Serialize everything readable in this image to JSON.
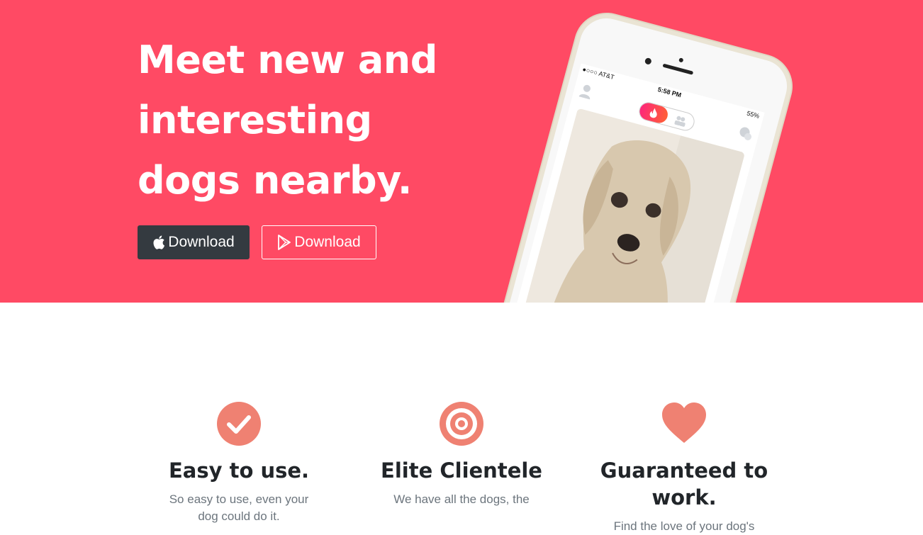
{
  "hero": {
    "headline": "Meet new and interesting dogs nearby.",
    "background_color": "#ff4a64",
    "buttons": {
      "apple_label": "Download",
      "play_label": "Download"
    }
  },
  "phone": {
    "carrier": "●○○○ AT&T",
    "time": "5:58 PM",
    "battery": "55%"
  },
  "features": [
    {
      "icon": "check-circle-icon",
      "title": "Easy to use.",
      "text": "So easy to use, even your dog could do it."
    },
    {
      "icon": "bullseye-icon",
      "title": "Elite Clientele",
      "text": "We have all the dogs, the"
    },
    {
      "icon": "heart-icon",
      "title": "Guaranteed to work.",
      "text": "Find the love of your dog's"
    }
  ],
  "accent_color": "#ef8172"
}
